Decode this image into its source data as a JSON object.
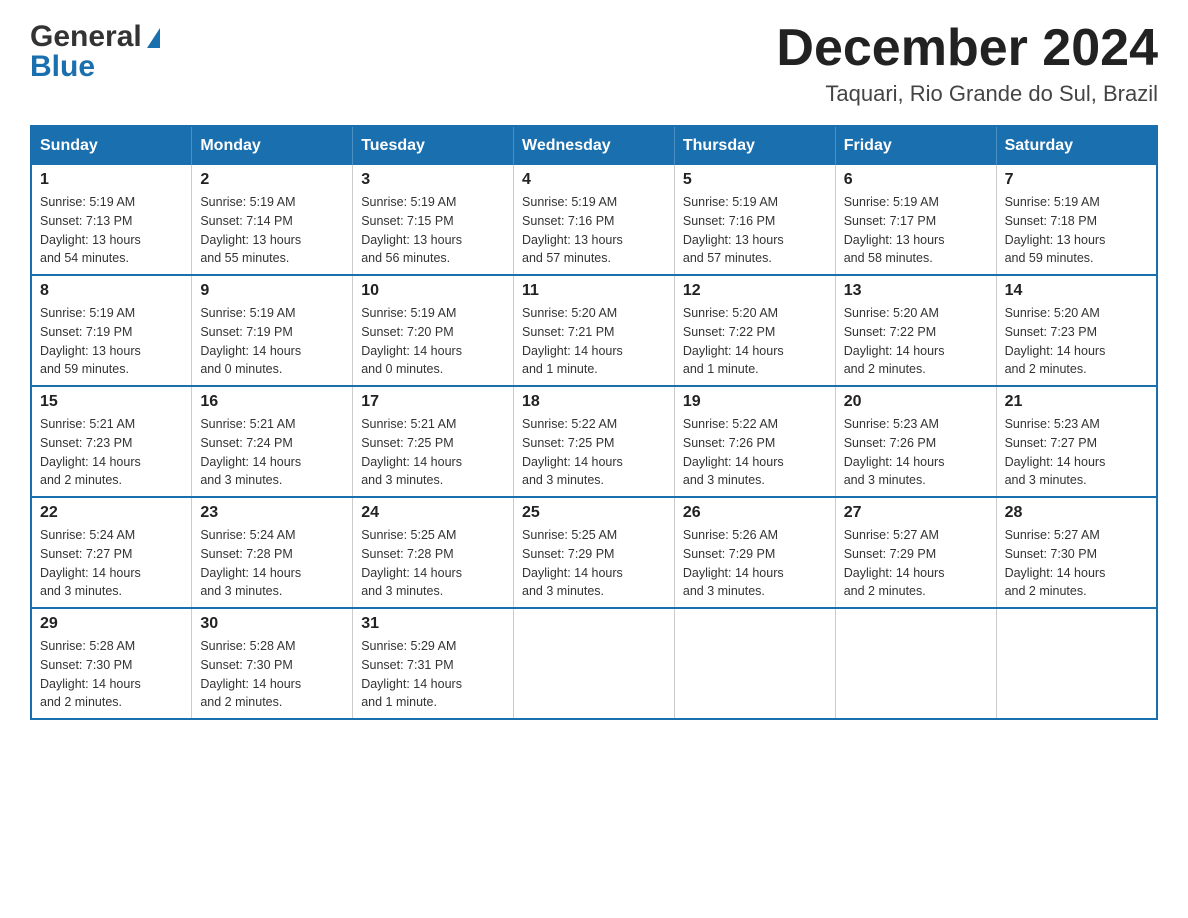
{
  "header": {
    "logo_general": "General",
    "logo_blue": "Blue",
    "month_year": "December 2024",
    "location": "Taquari, Rio Grande do Sul, Brazil"
  },
  "days_of_week": [
    "Sunday",
    "Monday",
    "Tuesday",
    "Wednesday",
    "Thursday",
    "Friday",
    "Saturday"
  ],
  "weeks": [
    [
      {
        "day": "1",
        "sunrise": "5:19 AM",
        "sunset": "7:13 PM",
        "daylight": "13 hours and 54 minutes."
      },
      {
        "day": "2",
        "sunrise": "5:19 AM",
        "sunset": "7:14 PM",
        "daylight": "13 hours and 55 minutes."
      },
      {
        "day": "3",
        "sunrise": "5:19 AM",
        "sunset": "7:15 PM",
        "daylight": "13 hours and 56 minutes."
      },
      {
        "day": "4",
        "sunrise": "5:19 AM",
        "sunset": "7:16 PM",
        "daylight": "13 hours and 57 minutes."
      },
      {
        "day": "5",
        "sunrise": "5:19 AM",
        "sunset": "7:16 PM",
        "daylight": "13 hours and 57 minutes."
      },
      {
        "day": "6",
        "sunrise": "5:19 AM",
        "sunset": "7:17 PM",
        "daylight": "13 hours and 58 minutes."
      },
      {
        "day": "7",
        "sunrise": "5:19 AM",
        "sunset": "7:18 PM",
        "daylight": "13 hours and 59 minutes."
      }
    ],
    [
      {
        "day": "8",
        "sunrise": "5:19 AM",
        "sunset": "7:19 PM",
        "daylight": "13 hours and 59 minutes."
      },
      {
        "day": "9",
        "sunrise": "5:19 AM",
        "sunset": "7:19 PM",
        "daylight": "14 hours and 0 minutes."
      },
      {
        "day": "10",
        "sunrise": "5:19 AM",
        "sunset": "7:20 PM",
        "daylight": "14 hours and 0 minutes."
      },
      {
        "day": "11",
        "sunrise": "5:20 AM",
        "sunset": "7:21 PM",
        "daylight": "14 hours and 1 minute."
      },
      {
        "day": "12",
        "sunrise": "5:20 AM",
        "sunset": "7:22 PM",
        "daylight": "14 hours and 1 minute."
      },
      {
        "day": "13",
        "sunrise": "5:20 AM",
        "sunset": "7:22 PM",
        "daylight": "14 hours and 2 minutes."
      },
      {
        "day": "14",
        "sunrise": "5:20 AM",
        "sunset": "7:23 PM",
        "daylight": "14 hours and 2 minutes."
      }
    ],
    [
      {
        "day": "15",
        "sunrise": "5:21 AM",
        "sunset": "7:23 PM",
        "daylight": "14 hours and 2 minutes."
      },
      {
        "day": "16",
        "sunrise": "5:21 AM",
        "sunset": "7:24 PM",
        "daylight": "14 hours and 3 minutes."
      },
      {
        "day": "17",
        "sunrise": "5:21 AM",
        "sunset": "7:25 PM",
        "daylight": "14 hours and 3 minutes."
      },
      {
        "day": "18",
        "sunrise": "5:22 AM",
        "sunset": "7:25 PM",
        "daylight": "14 hours and 3 minutes."
      },
      {
        "day": "19",
        "sunrise": "5:22 AM",
        "sunset": "7:26 PM",
        "daylight": "14 hours and 3 minutes."
      },
      {
        "day": "20",
        "sunrise": "5:23 AM",
        "sunset": "7:26 PM",
        "daylight": "14 hours and 3 minutes."
      },
      {
        "day": "21",
        "sunrise": "5:23 AM",
        "sunset": "7:27 PM",
        "daylight": "14 hours and 3 minutes."
      }
    ],
    [
      {
        "day": "22",
        "sunrise": "5:24 AM",
        "sunset": "7:27 PM",
        "daylight": "14 hours and 3 minutes."
      },
      {
        "day": "23",
        "sunrise": "5:24 AM",
        "sunset": "7:28 PM",
        "daylight": "14 hours and 3 minutes."
      },
      {
        "day": "24",
        "sunrise": "5:25 AM",
        "sunset": "7:28 PM",
        "daylight": "14 hours and 3 minutes."
      },
      {
        "day": "25",
        "sunrise": "5:25 AM",
        "sunset": "7:29 PM",
        "daylight": "14 hours and 3 minutes."
      },
      {
        "day": "26",
        "sunrise": "5:26 AM",
        "sunset": "7:29 PM",
        "daylight": "14 hours and 3 minutes."
      },
      {
        "day": "27",
        "sunrise": "5:27 AM",
        "sunset": "7:29 PM",
        "daylight": "14 hours and 2 minutes."
      },
      {
        "day": "28",
        "sunrise": "5:27 AM",
        "sunset": "7:30 PM",
        "daylight": "14 hours and 2 minutes."
      }
    ],
    [
      {
        "day": "29",
        "sunrise": "5:28 AM",
        "sunset": "7:30 PM",
        "daylight": "14 hours and 2 minutes."
      },
      {
        "day": "30",
        "sunrise": "5:28 AM",
        "sunset": "7:30 PM",
        "daylight": "14 hours and 2 minutes."
      },
      {
        "day": "31",
        "sunrise": "5:29 AM",
        "sunset": "7:31 PM",
        "daylight": "14 hours and 1 minute."
      },
      null,
      null,
      null,
      null
    ]
  ],
  "labels": {
    "sunrise": "Sunrise:",
    "sunset": "Sunset:",
    "daylight": "Daylight:"
  }
}
